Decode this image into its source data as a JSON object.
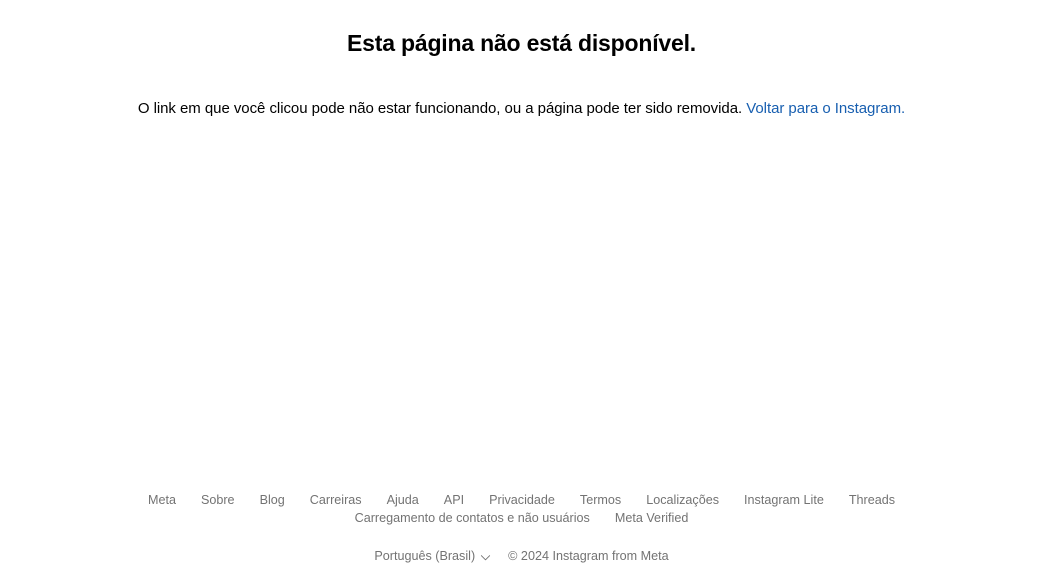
{
  "error": {
    "title": "Esta página não está disponível.",
    "body_text": "O link em que você clicou pode não estar funcionando, ou a página pode ter sido removida. ",
    "link_label": "Voltar para o Instagram.",
    "link_color": "#185fb0"
  },
  "footer": {
    "links": [
      {
        "label": "Meta"
      },
      {
        "label": "Sobre"
      },
      {
        "label": "Blog"
      },
      {
        "label": "Carreiras"
      },
      {
        "label": "Ajuda"
      },
      {
        "label": "API"
      },
      {
        "label": "Privacidade"
      },
      {
        "label": "Termos"
      },
      {
        "label": "Localizações"
      },
      {
        "label": "Instagram Lite"
      },
      {
        "label": "Threads"
      },
      {
        "label": "Carregamento de contatos e não usuários"
      },
      {
        "label": "Meta Verified"
      }
    ],
    "language": {
      "selected": "Português (Brasil)",
      "icon": "chevron-down-icon"
    },
    "copyright": "© 2024 Instagram from Meta",
    "text_color": "#737373"
  }
}
